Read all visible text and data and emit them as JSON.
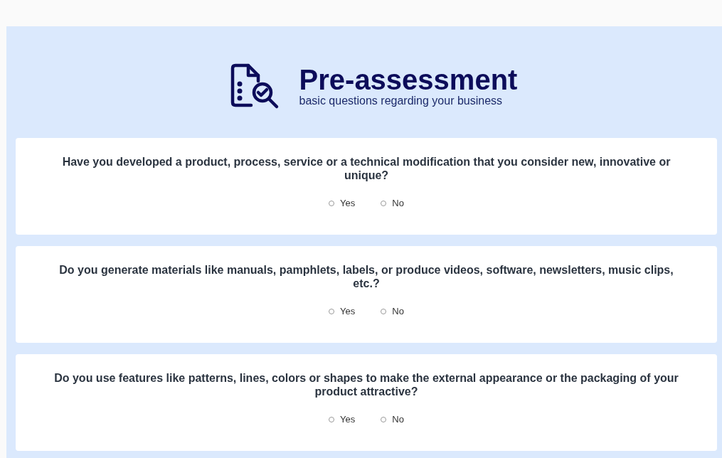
{
  "header": {
    "title": "Pre-assessment",
    "subtitle": "basic questions regarding your business"
  },
  "questions": [
    {
      "text": "Have you developed a product, process, service or a technical modification that you consider new, innovative or unique?",
      "options": [
        {
          "label": "Yes",
          "selected": false
        },
        {
          "label": "No",
          "selected": false
        }
      ]
    },
    {
      "text": "Do you generate materials like manuals, pamphlets, labels, or produce videos, software, newsletters, music clips, etc.?",
      "options": [
        {
          "label": "Yes",
          "selected": false
        },
        {
          "label": "No",
          "selected": false
        }
      ]
    },
    {
      "text": "Do you use features like patterns, lines, colors or shapes to make the external appearance or the packaging of your product attractive?",
      "options": [
        {
          "label": "Yes",
          "selected": false
        },
        {
          "label": "No",
          "selected": false
        }
      ]
    }
  ]
}
